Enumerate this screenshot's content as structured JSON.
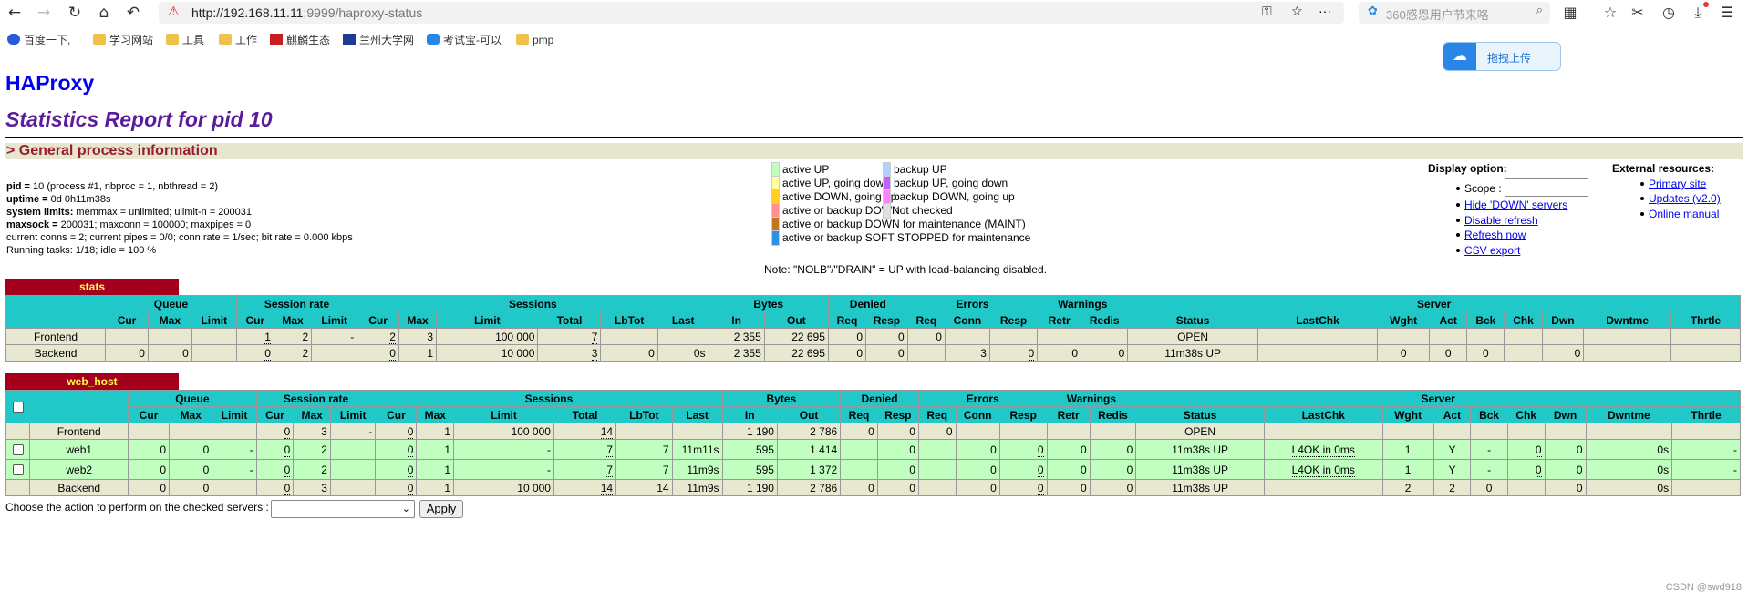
{
  "browser": {
    "url_host": "http://192.168.11.11",
    "url_rest": ":9999/haproxy-status",
    "search_placeholder": "360感恩用户节来咯",
    "bookmarks": [
      "百度一下,",
      "学习网站",
      "工具",
      "工作",
      "麒麟生态",
      "兰州大学网",
      "考试宝-可以",
      "pmp"
    ],
    "float_upload": "拖拽上传"
  },
  "page": {
    "title": "HAProxy",
    "subtitle": "Statistics Report for pid 10",
    "section": "> General process information",
    "process_lines": [
      {
        "b": "pid = ",
        "t": "10 (process #1, nbproc = 1, nbthread = 2)"
      },
      {
        "b": "uptime = ",
        "t": "0d 0h11m38s"
      },
      {
        "b": "system limits: ",
        "t": "memmax = unlimited; ulimit-n = 200031"
      },
      {
        "b": "maxsock = ",
        "t": "200031; maxconn = 100000; maxpipes = 0"
      },
      {
        "b": "",
        "t": "current conns = 2; current pipes = 0/0; conn rate = 1/sec; bit rate = 0.000 kbps"
      },
      {
        "b": "",
        "t": "Running tasks: 1/18; idle = 100 %"
      }
    ],
    "legend": [
      {
        "label": "active UP",
        "color": "#c0ffc0"
      },
      {
        "label": "backup UP",
        "color": "#b0d0ff"
      },
      {
        "label": "active UP, going down",
        "color": "#ffffa0"
      },
      {
        "label": "backup UP, going down",
        "color": "#c060ff"
      },
      {
        "label": "active DOWN, going up",
        "color": "#ffd020"
      },
      {
        "label": "backup DOWN, going up",
        "color": "#ff80ff"
      },
      {
        "label": "active or backup DOWN",
        "color": "#ff9090"
      },
      {
        "label": "not checked",
        "color": "#e0e0e0"
      },
      {
        "label": "active or backup DOWN for maintenance (MAINT)",
        "color": "#c07820"
      },
      {
        "label": "active or backup SOFT STOPPED for maintenance",
        "color": "#3090e0"
      }
    ],
    "legend_note": "Note: \"NOLB\"/\"DRAIN\" = UP with load-balancing disabled.",
    "display_option": {
      "title": "Display option:",
      "scope_label": "Scope :",
      "links": [
        "Hide 'DOWN' servers",
        "Disable refresh",
        "Refresh now",
        "CSV export"
      ]
    },
    "external": {
      "title": "External resources:",
      "links": [
        "Primary site",
        "Updates (v2.0)",
        "Online manual"
      ]
    },
    "action_label": "Choose the action to perform on the checked servers :",
    "apply_label": "Apply",
    "watermark": "CSDN @swd918"
  },
  "headers": {
    "groups": [
      "Queue",
      "Session rate",
      "Sessions",
      "Bytes",
      "Denied",
      "Errors",
      "Warnings",
      "Server"
    ],
    "cols": [
      "Cur",
      "Max",
      "Limit",
      "Cur",
      "Max",
      "Limit",
      "Cur",
      "Max",
      "Limit",
      "Total",
      "LbTot",
      "Last",
      "In",
      "Out",
      "Req",
      "Resp",
      "Req",
      "Conn",
      "Resp",
      "Retr",
      "Redis",
      "Status",
      "LastChk",
      "Wght",
      "Act",
      "Bck",
      "Chk",
      "Dwn",
      "Dwntme",
      "Thrtle"
    ]
  },
  "proxies": [
    {
      "name": "stats",
      "checkbox": false,
      "rows": [
        {
          "type": "fe",
          "name": "Frontend",
          "cells": [
            "",
            "",
            "",
            "1",
            "2",
            "-",
            "2",
            "3",
            "100 000",
            "7",
            "",
            "",
            "2 355",
            "22 695",
            "0",
            "0",
            "0",
            "",
            "",
            "",
            "",
            "OPEN",
            "",
            "",
            "",
            "",
            "",
            "",
            "",
            ""
          ]
        },
        {
          "type": "be",
          "name": "Backend",
          "cells": [
            "0",
            "0",
            "",
            "0",
            "2",
            "",
            "0",
            "1",
            "10 000",
            "3",
            "0",
            "0s",
            "2 355",
            "22 695",
            "0",
            "0",
            "",
            "3",
            "0",
            "0",
            "0",
            "11m38s UP",
            "",
            "0",
            "0",
            "0",
            "",
            "0",
            "",
            ""
          ]
        }
      ]
    },
    {
      "name": "web_host",
      "checkbox": true,
      "rows": [
        {
          "type": "fe",
          "name": "Frontend",
          "cells": [
            "",
            "",
            "",
            "0",
            "3",
            "-",
            "0",
            "1",
            "100 000",
            "14",
            "",
            "",
            "1 190",
            "2 786",
            "0",
            "0",
            "0",
            "",
            "",
            "",
            "",
            "OPEN",
            "",
            "",
            "",
            "",
            "",
            "",
            "",
            ""
          ]
        },
        {
          "type": "up",
          "name": "web1",
          "cells": [
            "0",
            "0",
            "-",
            "0",
            "2",
            "",
            "0",
            "1",
            "-",
            "7",
            "7",
            "11m11s",
            "595",
            "1 414",
            "",
            "0",
            "",
            "0",
            "0",
            "0",
            "0",
            "11m38s UP",
            "L4OK in 0ms",
            "1",
            "Y",
            "-",
            "0",
            "0",
            "0s",
            "-"
          ]
        },
        {
          "type": "up",
          "name": "web2",
          "cells": [
            "0",
            "0",
            "-",
            "0",
            "2",
            "",
            "0",
            "1",
            "-",
            "7",
            "7",
            "11m9s",
            "595",
            "1 372",
            "",
            "0",
            "",
            "0",
            "0",
            "0",
            "0",
            "11m38s UP",
            "L4OK in 0ms",
            "1",
            "Y",
            "-",
            "0",
            "0",
            "0s",
            "-"
          ]
        },
        {
          "type": "be",
          "name": "Backend",
          "cells": [
            "0",
            "0",
            "",
            "0",
            "3",
            "",
            "0",
            "1",
            "10 000",
            "14",
            "14",
            "11m9s",
            "1 190",
            "2 786",
            "0",
            "0",
            "",
            "0",
            "0",
            "0",
            "0",
            "11m38s UP",
            "",
            "2",
            "2",
            "0",
            "",
            "0",
            "0s",
            ""
          ]
        }
      ]
    }
  ]
}
